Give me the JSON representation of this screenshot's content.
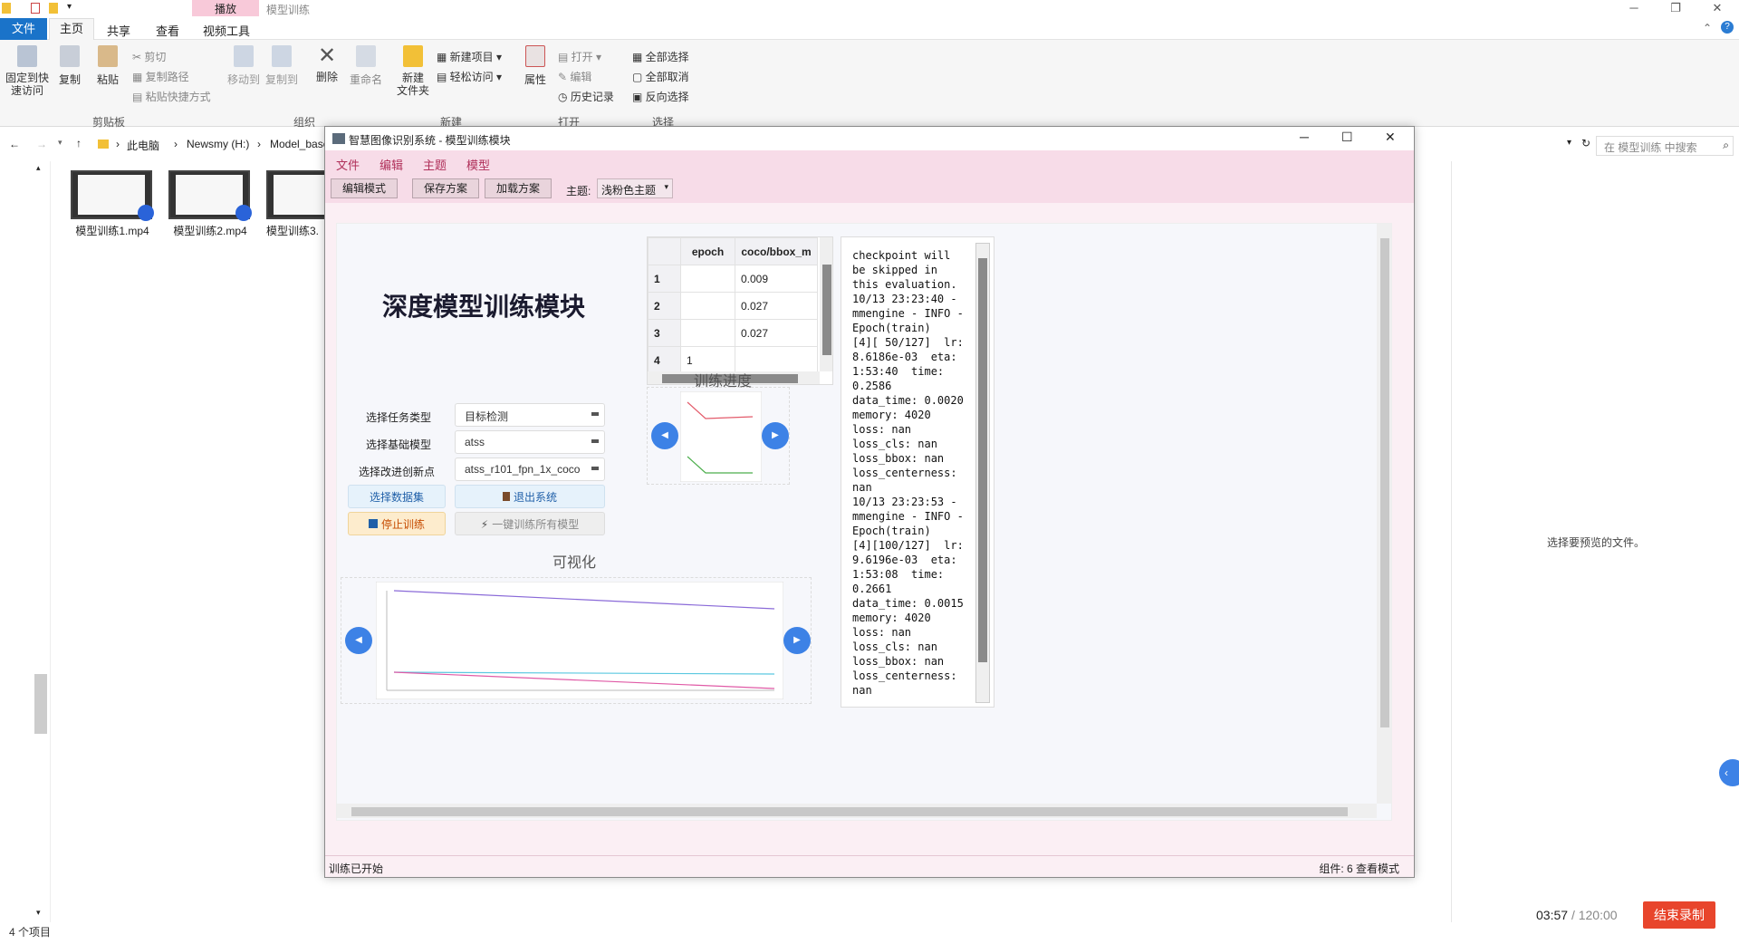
{
  "explorer": {
    "context_tab": "播放",
    "window_title": "模型训练",
    "tabs": [
      "文件",
      "主页",
      "共享",
      "查看",
      "视频工具"
    ],
    "ribbon": {
      "pin": "固定到快\n速访问",
      "copy": "复制",
      "paste": "粘贴",
      "cut": "剪切",
      "copy_path": "复制路径",
      "paste_shortcut": "粘贴快捷方式",
      "move_to": "移动到",
      "copy_to": "复制到",
      "delete": "删除",
      "rename": "重命名",
      "new_folder": "新建\n文件夹",
      "new_item": "新建项目",
      "easy_access": "轻松访问",
      "properties": "属性",
      "open": "打开",
      "edit": "编辑",
      "history": "历史记录",
      "select_all": "全部选择",
      "select_none": "全部取消",
      "invert": "反向选择",
      "groups": [
        "剪贴板",
        "组织",
        "新建",
        "打开",
        "选择"
      ]
    },
    "breadcrumb": [
      "此电脑",
      "Newsmy (H:)",
      "Model_base"
    ],
    "search_placeholder": "在 模型训练 中搜索",
    "files": [
      "模型训练1.mp4",
      "模型训练2.mp4",
      "模型训练3."
    ],
    "preview_text": "选择要预览的文件。",
    "item_count": "4 个项目"
  },
  "app": {
    "title": "智慧图像识别系统 - 模型训练模块",
    "menu": [
      "文件",
      "编辑",
      "主题",
      "模型"
    ],
    "toolbar": {
      "edit_mode": "编辑模式",
      "save_plan": "保存方案",
      "load_plan": "加载方案",
      "theme_label": "主题:",
      "theme_value": "浅粉色主题"
    },
    "heading": "深度模型训练模块",
    "controls": {
      "task_label": "选择任务类型",
      "task_value": "目标检测",
      "base_label": "选择基础模型",
      "base_value": "atss",
      "ckpt_label": "选择改进创新点",
      "ckpt_value": "atss_r101_fpn_1x_coco",
      "dataset_btn": "选择数据集",
      "exit_btn": "退出系统",
      "stop_btn": "停止训练",
      "train_all_btn": "一键训练所有模型"
    },
    "table": {
      "headers": [
        "",
        "epoch",
        "coco/bbox_m"
      ],
      "rows": [
        [
          "1",
          "",
          "0.009"
        ],
        [
          "2",
          "",
          "0.027"
        ],
        [
          "3",
          "",
          "0.027"
        ],
        [
          "4",
          "1",
          ""
        ]
      ]
    },
    "progress_title": "训练进度",
    "viz_title": "可视化",
    "log": "checkpoint will\nbe skipped in\nthis evaluation.\n10/13 23:23:40 -\nmmengine - INFO -\nEpoch(train)\n[4][ 50/127]  lr:\n8.6186e-03  eta:\n1:53:40  time:\n0.2586\ndata_time: 0.0020\nmemory: 4020\nloss: nan\nloss_cls: nan\nloss_bbox: nan\nloss_centerness:\nnan\n10/13 23:23:53 -\nmmengine - INFO -\nEpoch(train)\n[4][100/127]  lr:\n9.6196e-03  eta:\n1:53:08  time:\n0.2661\ndata_time: 0.0015\nmemory: 4020\nloss: nan\nloss_cls: nan\nloss_bbox: nan\nloss_centerness:\nnan",
    "status_left": "训练已开始",
    "status_right": "组件: 6  查看模式"
  },
  "recorder": {
    "time": "03:57",
    "total": "/ 120:00",
    "end_btn": "结束录制"
  }
}
